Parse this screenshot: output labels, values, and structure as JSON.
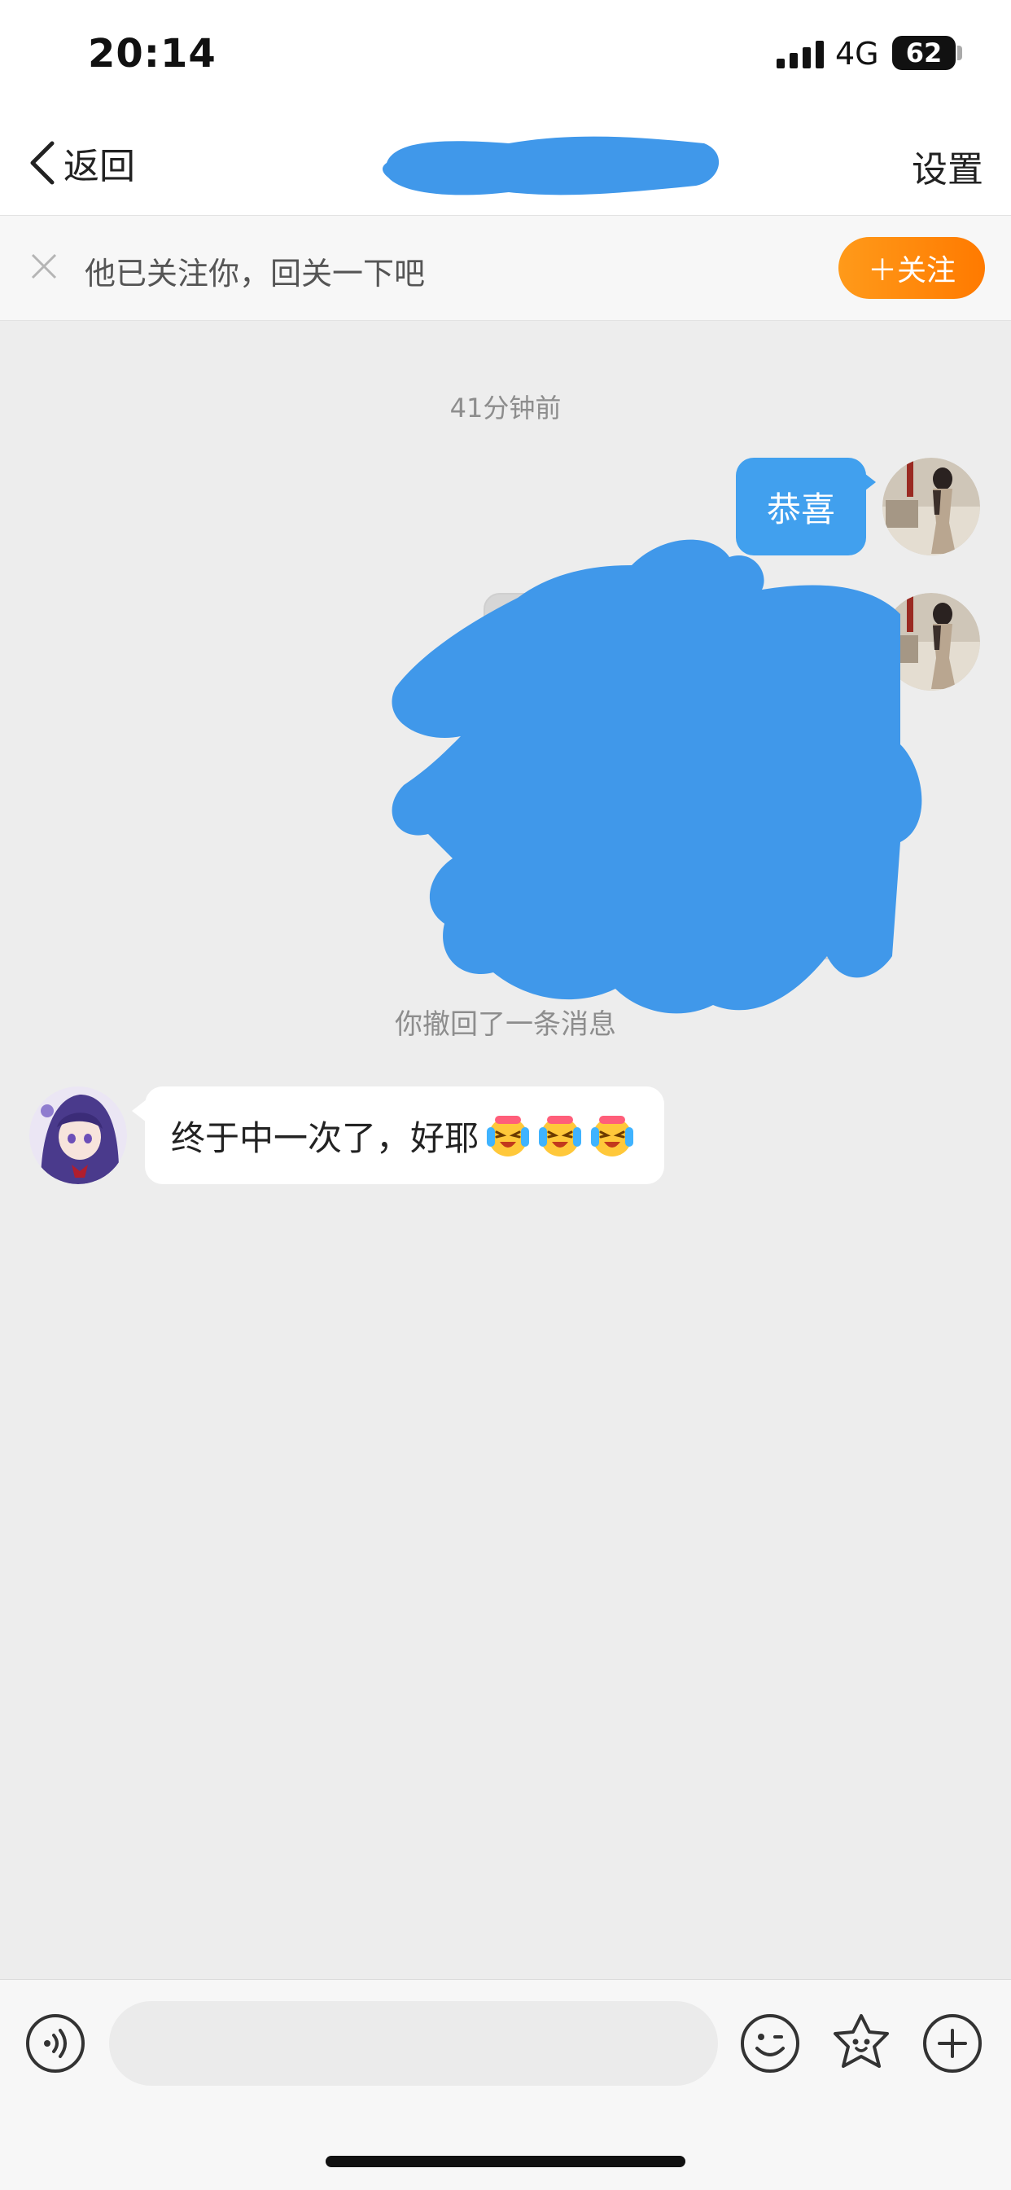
{
  "status_bar": {
    "time": "20:14",
    "network": "4G",
    "battery": "62"
  },
  "nav": {
    "back_label": "返回",
    "settings_label": "设置"
  },
  "follow_banner": {
    "text": "他已关注你，回关一下吧",
    "button_label": "＋关注",
    "button_color": "#ff8a00"
  },
  "chat": {
    "timestamp": "41分钟前",
    "messages": [
      {
        "sender": "me",
        "type": "text",
        "text": "恭喜"
      },
      {
        "sender": "me",
        "type": "image",
        "note": ""
      },
      {
        "sender": "system",
        "type": "notice",
        "text": "你撤回了一条消息"
      },
      {
        "sender": "other",
        "type": "text",
        "text": "终于中一次了，好耶",
        "emojis": [
          "crying-laughing-emoji",
          "crying-laughing-emoji",
          "crying-laughing-emoji"
        ]
      }
    ],
    "my_bubble_color": "#41a0ee",
    "redaction_color": "#4098ea"
  },
  "input_bar": {
    "placeholder": "",
    "icons": [
      "voice-icon",
      "emoji-icon",
      "sticker-icon",
      "plus-icon"
    ]
  }
}
